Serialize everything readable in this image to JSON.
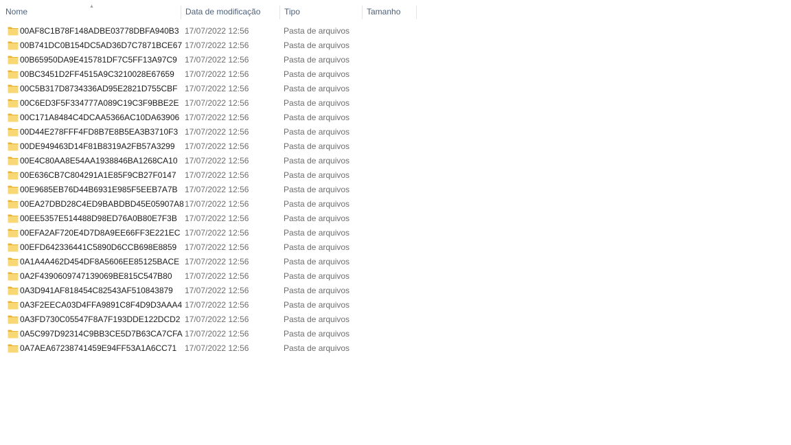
{
  "columns": {
    "name": "Nome",
    "date": "Data de modificação",
    "type": "Tipo",
    "size": "Tamanho"
  },
  "sort_icon": "chevron-up-icon",
  "folder_color": "#F8D775",
  "folder_dark_color": "#E8B230",
  "files": [
    {
      "name": "00AF8C1B78F148ADBE03778DBFA940B3",
      "date": "17/07/2022 12:56",
      "type": "Pasta de arquivos",
      "size": ""
    },
    {
      "name": "00B741DC0B154DC5AD36D7C7871BCE67",
      "date": "17/07/2022 12:56",
      "type": "Pasta de arquivos",
      "size": ""
    },
    {
      "name": "00B65950DA9E415781DF7C5FF13A97C9",
      "date": "17/07/2022 12:56",
      "type": "Pasta de arquivos",
      "size": ""
    },
    {
      "name": "00BC3451D2FF4515A9C3210028E67659",
      "date": "17/07/2022 12:56",
      "type": "Pasta de arquivos",
      "size": ""
    },
    {
      "name": "00C5B317D8734336AD95E2821D755CBF",
      "date": "17/07/2022 12:56",
      "type": "Pasta de arquivos",
      "size": ""
    },
    {
      "name": "00C6ED3F5F334777A089C19C3F9BBE2E",
      "date": "17/07/2022 12:56",
      "type": "Pasta de arquivos",
      "size": ""
    },
    {
      "name": "00C171A8484C4DCAA5366AC10DA63906",
      "date": "17/07/2022 12:56",
      "type": "Pasta de arquivos",
      "size": ""
    },
    {
      "name": "00D44E278FFF4FD8B7E8B5EA3B3710F3",
      "date": "17/07/2022 12:56",
      "type": "Pasta de arquivos",
      "size": ""
    },
    {
      "name": "00DE949463D14F81B8319A2FB57A3299",
      "date": "17/07/2022 12:56",
      "type": "Pasta de arquivos",
      "size": ""
    },
    {
      "name": "00E4C80AA8E54AA1938846BA1268CA10",
      "date": "17/07/2022 12:56",
      "type": "Pasta de arquivos",
      "size": ""
    },
    {
      "name": "00E636CB7C804291A1E85F9CB27F0147",
      "date": "17/07/2022 12:56",
      "type": "Pasta de arquivos",
      "size": ""
    },
    {
      "name": "00E9685EB76D44B6931E985F5EEB7A7B",
      "date": "17/07/2022 12:56",
      "type": "Pasta de arquivos",
      "size": ""
    },
    {
      "name": "00EA27DBD28C4ED9BABDBD45E05907A8",
      "date": "17/07/2022 12:56",
      "type": "Pasta de arquivos",
      "size": ""
    },
    {
      "name": "00EE5357E514488D98ED76A0B80E7F3B",
      "date": "17/07/2022 12:56",
      "type": "Pasta de arquivos",
      "size": ""
    },
    {
      "name": "00EFA2AF720E4D7D8A9EE66FF3E221EC",
      "date": "17/07/2022 12:56",
      "type": "Pasta de arquivos",
      "size": ""
    },
    {
      "name": "00EFD642336441C5890D6CCB698E8859",
      "date": "17/07/2022 12:56",
      "type": "Pasta de arquivos",
      "size": ""
    },
    {
      "name": "0A1A4A462D454DF8A5606EE85125BACE",
      "date": "17/07/2022 12:56",
      "type": "Pasta de arquivos",
      "size": ""
    },
    {
      "name": "0A2F4390609747139069BE815C547B80",
      "date": "17/07/2022 12:56",
      "type": "Pasta de arquivos",
      "size": ""
    },
    {
      "name": "0A3D941AF818454C82543AF510843879",
      "date": "17/07/2022 12:56",
      "type": "Pasta de arquivos",
      "size": ""
    },
    {
      "name": "0A3F2EECA03D4FFA9891C8F4D9D3AAA4",
      "date": "17/07/2022 12:56",
      "type": "Pasta de arquivos",
      "size": ""
    },
    {
      "name": "0A3FD730C05547F8A7F193DDE122DCD2",
      "date": "17/07/2022 12:56",
      "type": "Pasta de arquivos",
      "size": ""
    },
    {
      "name": "0A5C997D92314C9BB3CE5D7B63CA7CFA",
      "date": "17/07/2022 12:56",
      "type": "Pasta de arquivos",
      "size": ""
    },
    {
      "name": "0A7AEA67238741459E94FF53A1A6CC71",
      "date": "17/07/2022 12:56",
      "type": "Pasta de arquivos",
      "size": ""
    }
  ]
}
